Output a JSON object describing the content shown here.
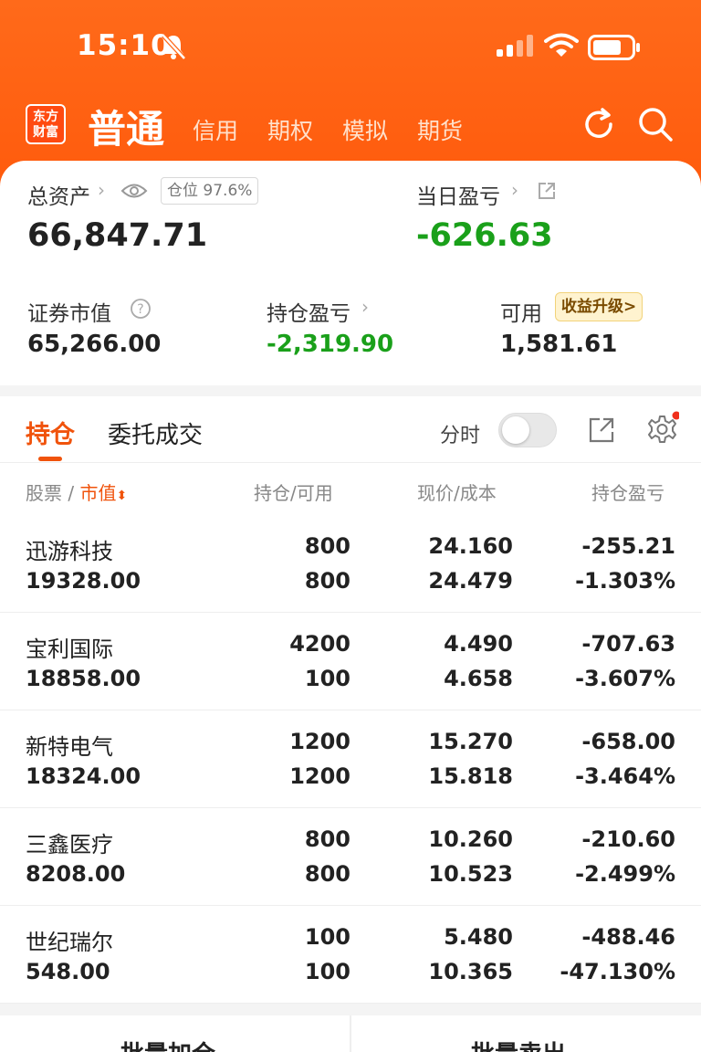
{
  "status": {
    "time": "15:10"
  },
  "nav": {
    "logo": [
      "东方",
      "财富"
    ],
    "active": "普通",
    "tabs": [
      "信用",
      "期权",
      "模拟",
      "期货"
    ]
  },
  "summary": {
    "total_assets_label": "总资产",
    "position_badge": "仓位 97.6%",
    "total_assets": "66,847.71",
    "daily_pnl_label": "当日盈亏",
    "daily_pnl": "-626.63",
    "market_value_label": "证券市值",
    "market_value": "65,266.00",
    "holding_pnl_label": "持仓盈亏",
    "holding_pnl": "-2,319.90",
    "available_label": "可用",
    "upgrade_badge": "收益升级>",
    "available": "1,581.61"
  },
  "panel": {
    "tab_active": "持仓",
    "tab_other": "委托成交",
    "intraday_label": "分时",
    "columns": {
      "stock": "股票",
      "market_value": "市值",
      "holding": "持仓/可用",
      "price": "现价/成本",
      "pnl": "持仓盈亏"
    }
  },
  "holdings": [
    {
      "name": "迅游科技",
      "mv": "19328.00",
      "qty": "800",
      "avail": "800",
      "price": "24.160",
      "cost": "24.479",
      "pnl": "-255.21",
      "pct": "-1.303%"
    },
    {
      "name": "宝利国际",
      "mv": "18858.00",
      "qty": "4200",
      "avail": "100",
      "price": "4.490",
      "cost": "4.658",
      "pnl": "-707.63",
      "pct": "-3.607%"
    },
    {
      "name": "新特电气",
      "mv": "18324.00",
      "qty": "1200",
      "avail": "1200",
      "price": "15.270",
      "cost": "15.818",
      "pnl": "-658.00",
      "pct": "-3.464%"
    },
    {
      "name": "三鑫医疗",
      "mv": "8208.00",
      "qty": "800",
      "avail": "800",
      "price": "10.260",
      "cost": "10.523",
      "pnl": "-210.60",
      "pct": "-2.499%"
    },
    {
      "name": "世纪瑞尔",
      "mv": "548.00",
      "qty": "100",
      "avail": "100",
      "price": "5.480",
      "cost": "10.365",
      "pnl": "-488.46",
      "pct": "-47.130%"
    }
  ],
  "bottom": {
    "add": "批量加仓",
    "sell": "批量卖出"
  },
  "colors": {
    "accent": "#ff5a0c",
    "loss": "#1aa01a"
  }
}
